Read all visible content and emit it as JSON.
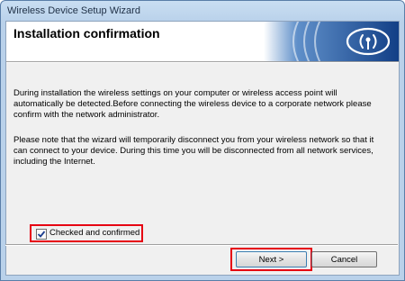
{
  "window": {
    "title": "Wireless Device Setup Wizard"
  },
  "banner": {
    "heading": "Installation confirmation",
    "logo_icon": "wireless-signal-icon"
  },
  "content": {
    "paragraph1": "During installation the wireless settings on your computer or wireless access point will automatically be detected.Before connecting the wireless device to a corporate network please confirm with the network administrator.",
    "paragraph2": "Please note that the wizard will temporarily disconnect you from your wireless network so that it can connect to your device. During this time you will be disconnected from all network services, including the Internet."
  },
  "confirm": {
    "label": "Checked and confirmed",
    "checked": true
  },
  "buttons": {
    "next": "Next >",
    "cancel": "Cancel"
  },
  "colors": {
    "highlight": "#e60012",
    "banner_blue": "#1f5aa6"
  }
}
